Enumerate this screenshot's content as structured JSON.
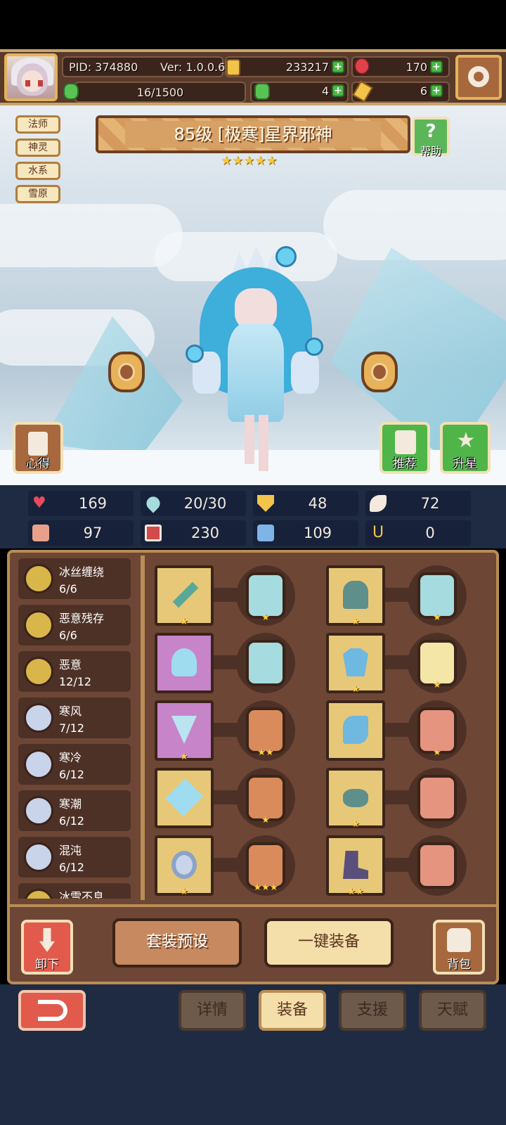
{
  "header": {
    "pid": "PID: 374880",
    "version": "Ver: 1.0.0.6",
    "gold": "233217",
    "ruby": "170",
    "energy": "16/1500",
    "clover": "4",
    "key": "6"
  },
  "tags": [
    "法师",
    "神灵",
    "水系",
    "雪原"
  ],
  "character": {
    "title": "85级 [极寒]星界邪神",
    "stars": "★★★★★",
    "help_label": "帮助"
  },
  "scene_buttons": {
    "insight": "心得",
    "recommend": "推荐",
    "star_up": "升星"
  },
  "stats": [
    {
      "icon": "heart-icon",
      "value": "169"
    },
    {
      "icon": "mana-drop-icon",
      "value": "20/30"
    },
    {
      "icon": "shield-icon",
      "value": "48"
    },
    {
      "icon": "feather-icon",
      "value": "72"
    },
    {
      "icon": "fist-icon",
      "value": "97"
    },
    {
      "icon": "book-icon",
      "value": "230"
    },
    {
      "icon": "boot-icon",
      "value": "109"
    },
    {
      "icon": "magnet-icon",
      "value": "0"
    }
  ],
  "sets": [
    {
      "name": "冰丝缠绕",
      "count": "6/6",
      "icon": "gold-set-icon"
    },
    {
      "name": "恶意残存",
      "count": "6/6",
      "icon": "gold-set-icon"
    },
    {
      "name": "恶意",
      "count": "12/12",
      "icon": "gold-set-icon"
    },
    {
      "name": "寒风",
      "count": "7/12",
      "icon": "silver-set-icon"
    },
    {
      "name": "寒冷",
      "count": "6/12",
      "icon": "silver-set-icon"
    },
    {
      "name": "寒潮",
      "count": "6/12",
      "icon": "silver-set-icon"
    },
    {
      "name": "混沌",
      "count": "6/12",
      "icon": "silver-set-icon"
    },
    {
      "name": "冰雪不息",
      "count": "",
      "icon": "gold-set-icon"
    }
  ],
  "equipment": [
    {
      "slot": "staff",
      "stars": "★",
      "card_stars": "★",
      "slot_color": "#e7c879",
      "card_color": "#a6dbe0"
    },
    {
      "slot": "helmet",
      "stars": "★",
      "card_stars": "★",
      "slot_color": "#e7c879",
      "card_color": "#a6dbe0"
    },
    {
      "slot": "amulet-flask",
      "stars": "",
      "card_stars": "",
      "slot_color": "#c784c9",
      "card_color": "#a6dbe0"
    },
    {
      "slot": "armor",
      "stars": "★",
      "card_stars": "★",
      "slot_color": "#e7c879",
      "card_color": "#f4e6a6"
    },
    {
      "slot": "necklace",
      "stars": "★",
      "card_stars": "★★",
      "slot_color": "#c784c9",
      "card_color": "#d98b5c"
    },
    {
      "slot": "cloak",
      "stars": "",
      "card_stars": "★",
      "slot_color": "#e7c879",
      "card_color": "#e59480"
    },
    {
      "slot": "crystal-gem",
      "stars": "",
      "card_stars": "★",
      "slot_color": "#e7c879",
      "card_color": "#d98b5c"
    },
    {
      "slot": "belt",
      "stars": "★",
      "card_stars": "",
      "slot_color": "#e7c879",
      "card_color": "#e59480"
    },
    {
      "slot": "ring",
      "stars": "★",
      "card_stars": "★★★",
      "slot_color": "#e7c879",
      "card_color": "#d98b5c"
    },
    {
      "slot": "boots",
      "stars": "★★",
      "card_stars": "",
      "slot_color": "#e7c879",
      "card_color": "#e59480"
    }
  ],
  "actions": {
    "unload": "卸下",
    "preset": "套装预设",
    "equip_all": "一键装备",
    "bag": "背包"
  },
  "nav": {
    "details": "详情",
    "equipment": "装备",
    "support": "支援",
    "talent": "天赋"
  }
}
